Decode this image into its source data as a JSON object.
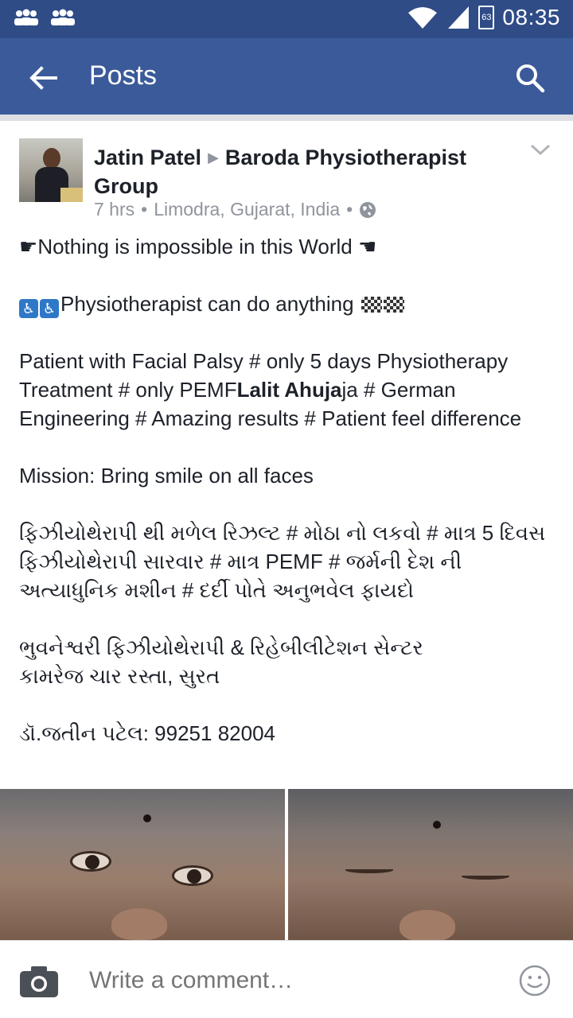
{
  "status_bar": {
    "time": "08:35",
    "battery_label": "63",
    "icons": [
      "group-icon",
      "group-icon",
      "wifi-icon",
      "signal-icon",
      "battery-icon"
    ]
  },
  "app_bar": {
    "title": "Posts",
    "back_icon": "back-arrow-icon",
    "search_icon": "search-icon"
  },
  "post": {
    "author": "Jatin Patel",
    "group": "Baroda Physiotherapist Group",
    "time": "7 hrs",
    "location": "Limodra, Gujarat, India",
    "separator": "•",
    "privacy_icon": "globe-icon",
    "line1": "Nothing is impossible in this World",
    "line2": "Physiotherapist can do anything",
    "paragraph3_pre": " Patient with Facial Palsy # only 5 days Physiotherapy Treatment #  only PEMF",
    "paragraph3_bold": "Lalit Ahuja",
    "paragraph3_post": "ja # German Engineering # Amazing results # Patient  feel difference",
    "mission": "Mission: Bring smile on all faces",
    "gujarati_paragraph": "ફિઝીયોથેરાપી થી મળેલ રિઝલ્ટ # મોઠા નો લકવો # માત્ર 5 દિવસ ફિઝીયોથેરાપી સારવાર # માત્ર  PEMF  # જર્મની દેશ ની અત્યાધુનિક મશીન # દર્દી પોતે અનુભવેલ ફાયદો",
    "clinic_line1": "ભુવનેશ્વરી ફિઝીયોથેરાપી & રિહેબીલીટેશન સેન્ટર",
    "clinic_line2": "કામરેજ ચાર રસ્તા, સુરત",
    "contact": "ડૉ.જતીન પટેલ:  99251 82004"
  },
  "comment_bar": {
    "placeholder": "Write a comment…",
    "camera_icon": "camera-icon",
    "emoji_icon": "smiley-icon"
  },
  "colors": {
    "status_bar": "#2f4c87",
    "app_bar": "#3b5a9a",
    "text_primary": "#1d2129",
    "text_secondary": "#90949c"
  }
}
